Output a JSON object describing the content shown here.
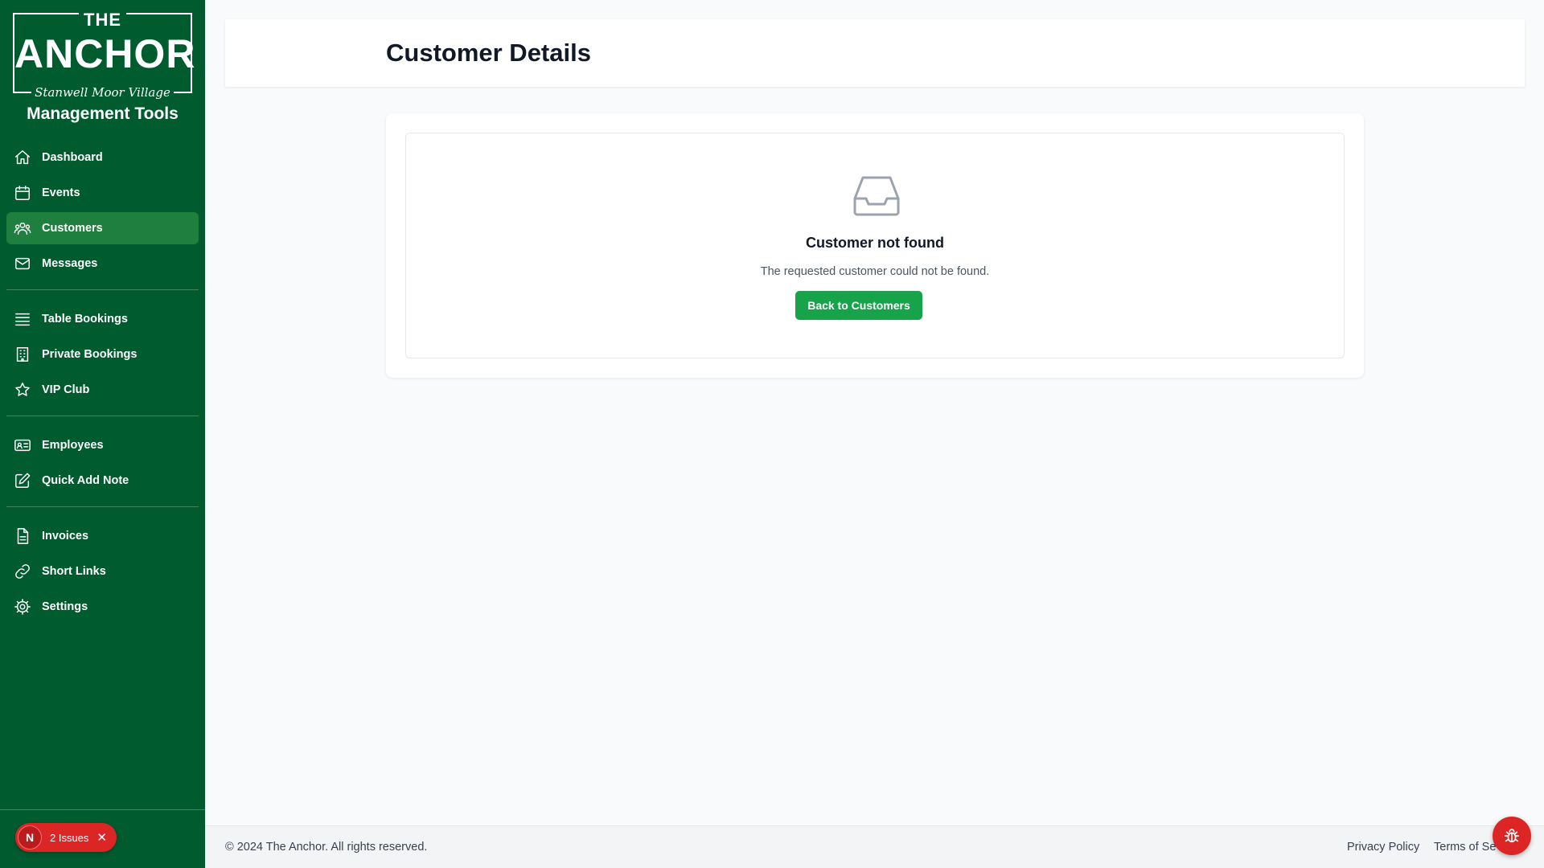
{
  "logo": {
    "top": "THE",
    "name": "ANCHOR",
    "sub": "Stanwell Moor Village"
  },
  "sidebar": {
    "title": "Management Tools",
    "groups": [
      [
        {
          "label": "Dashboard",
          "icon": "home-icon"
        },
        {
          "label": "Events",
          "icon": "calendar-icon"
        },
        {
          "label": "Customers",
          "icon": "users-icon",
          "active": true
        },
        {
          "label": "Messages",
          "icon": "envelope-icon"
        }
      ],
      [
        {
          "label": "Table Bookings",
          "icon": "table-icon"
        },
        {
          "label": "Private Bookings",
          "icon": "building-icon"
        },
        {
          "label": "VIP Club",
          "icon": "star-icon"
        }
      ],
      [
        {
          "label": "Employees",
          "icon": "id-card-icon"
        },
        {
          "label": "Quick Add Note",
          "icon": "pencil-square-icon"
        }
      ],
      [
        {
          "label": "Invoices",
          "icon": "document-icon"
        },
        {
          "label": "Short Links",
          "icon": "link-icon"
        },
        {
          "label": "Settings",
          "icon": "gear-icon"
        }
      ]
    ],
    "issues": {
      "badge": "N",
      "label": "2 Issues",
      "close": "✕"
    }
  },
  "header": {
    "title": "Customer Details"
  },
  "empty_state": {
    "icon": "inbox-icon",
    "title": "Customer not found",
    "description": "The requested customer could not be found.",
    "button": "Back to Customers"
  },
  "footer": {
    "copyright": "© 2024 The Anchor. All rights reserved.",
    "links": [
      "Privacy Policy",
      "Terms of Se"
    ]
  },
  "colors": {
    "sidebar": "#005b2f",
    "active": "#1f7f3f",
    "primary_button": "#16a34a",
    "issues": "#dc2626"
  }
}
